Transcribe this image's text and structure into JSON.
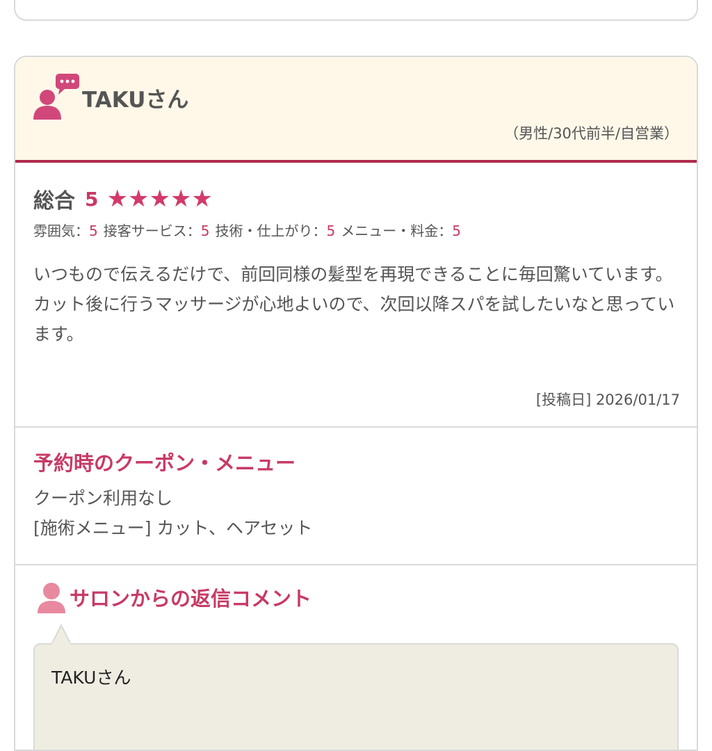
{
  "review": {
    "user_name": "TAKUさん",
    "user_meta": "（男性/30代前半/自営業）",
    "overall_label": "総合",
    "overall_score": "5",
    "stars": [
      "★",
      "★",
      "★",
      "★",
      "★"
    ],
    "sub_ratings": [
      {
        "label": "雰囲気：",
        "value": "5"
      },
      {
        "label": "接客サービス：",
        "value": "5"
      },
      {
        "label": "技術・仕上がり：",
        "value": "5"
      },
      {
        "label": "メニュー・料金：",
        "value": "5"
      }
    ],
    "comment": "いつもので伝えるだけで、前回同様の髪型を再現できることに毎回驚いています。\nカット後に行うマッサージが心地よいので、次回以降スパを試したいなと思っています。",
    "post_date": "[投稿日] 2026/01/17"
  },
  "coupon": {
    "title": "予約時のクーポン・メニュー",
    "coupon_text": "クーポン利用なし",
    "menu_text": "[施術メニュー] カット、ヘアセット"
  },
  "reply": {
    "title": "サロンからの返信コメント",
    "text": "TAKUさん"
  },
  "colors": {
    "accent": "#c83a66",
    "header_bg": "#fff8e9",
    "header_border": "#b02a4e",
    "bubble_bg": "#efede2"
  }
}
